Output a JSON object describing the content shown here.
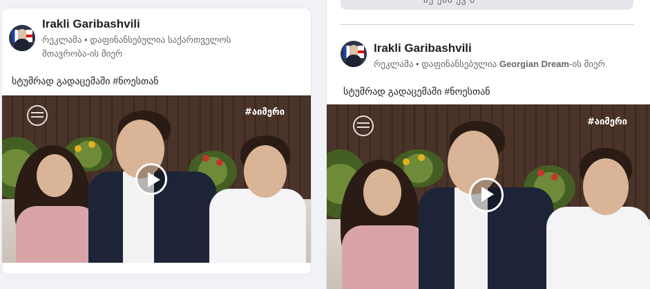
{
  "posts": [
    {
      "author": "Irakli Garibashvili",
      "sponsored_label": "რეკლამა",
      "separator": "•",
      "funding_prefix": "დაფინანსებულია",
      "funder": "საქართველოს მთავრობა",
      "funding_suffix": "-ის მიერ",
      "caption": "სტუმრად გადაცემაში #ნოესთან",
      "video_hashtag": "#აიმერი"
    },
    {
      "author": "Irakli Garibashvili",
      "sponsored_label": "რეკლამა",
      "separator": "•",
      "funding_prefix": "დაფინანსებულია",
      "funder": "Georgian Dream",
      "funding_suffix": "-ის მიერ",
      "caption": "სტუმრად გადაცემაში #ნოესთან",
      "video_hashtag": "#აიმერი"
    }
  ],
  "top_bar_text": "აქ      ეაბ  ეკ         ბ"
}
